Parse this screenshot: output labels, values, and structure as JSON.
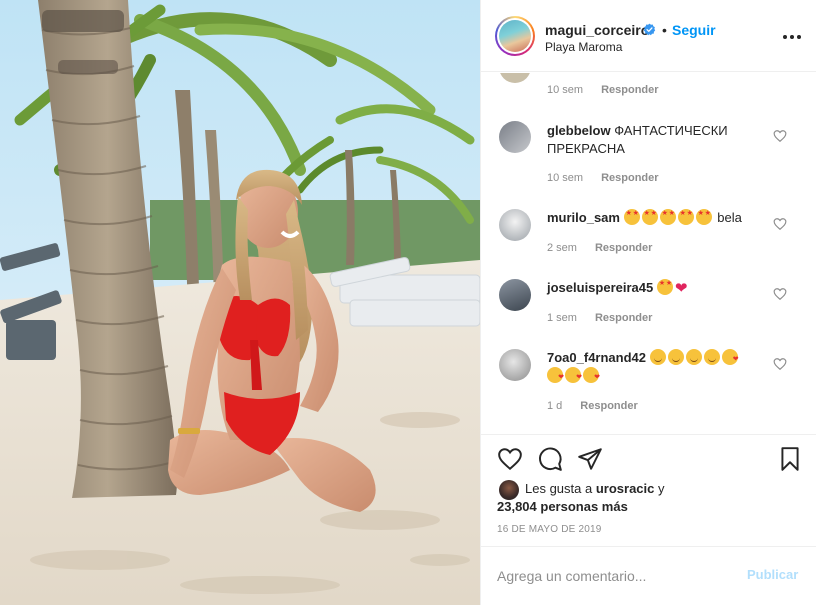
{
  "post": {
    "username": "magui_corceiro",
    "separator": "•",
    "follow_label": "Seguir",
    "location": "Playa Maroma",
    "more_icon": "more-options-icon"
  },
  "comments": [
    {
      "username": "",
      "text": "",
      "time": "10 sem",
      "reply": "Responder"
    },
    {
      "username": "glebbelow",
      "text": "ФАНТАСТИЧЕСКИ ПРЕКРАСНА",
      "time": "10 sem",
      "reply": "Responder"
    },
    {
      "username": "murilo_sam",
      "text": "bela",
      "emojis": [
        "star-struck",
        "star-struck",
        "star-struck",
        "star-struck",
        "star-struck"
      ],
      "time": "2 sem",
      "reply": "Responder"
    },
    {
      "username": "joseluispereira45",
      "text": "",
      "emojis": [
        "star-struck",
        "red-heart"
      ],
      "time": "1 sem",
      "reply": "Responder"
    },
    {
      "username": "7oa0_f4rnand42",
      "text": "",
      "emojis": [
        "smiling-face",
        "smiling-face",
        "smiling-face",
        "smiling-face",
        "kissing-face",
        "kissing-face",
        "kissing-face",
        "kissing-face"
      ],
      "time": "1 d",
      "reply": "Responder"
    }
  ],
  "likes": {
    "prefix": "Les gusta a",
    "user": "urosracic",
    "suffix": "y",
    "count_text": "23,804 personas más"
  },
  "date": "16 de mayo de 2019",
  "add_comment": {
    "placeholder": "Agrega un comentario...",
    "publish_label": "Publicar"
  },
  "colors": {
    "accent": "#0095f6",
    "publish_disabled": "#b2dffc",
    "muted": "#8e8e8e",
    "text": "#262626"
  }
}
